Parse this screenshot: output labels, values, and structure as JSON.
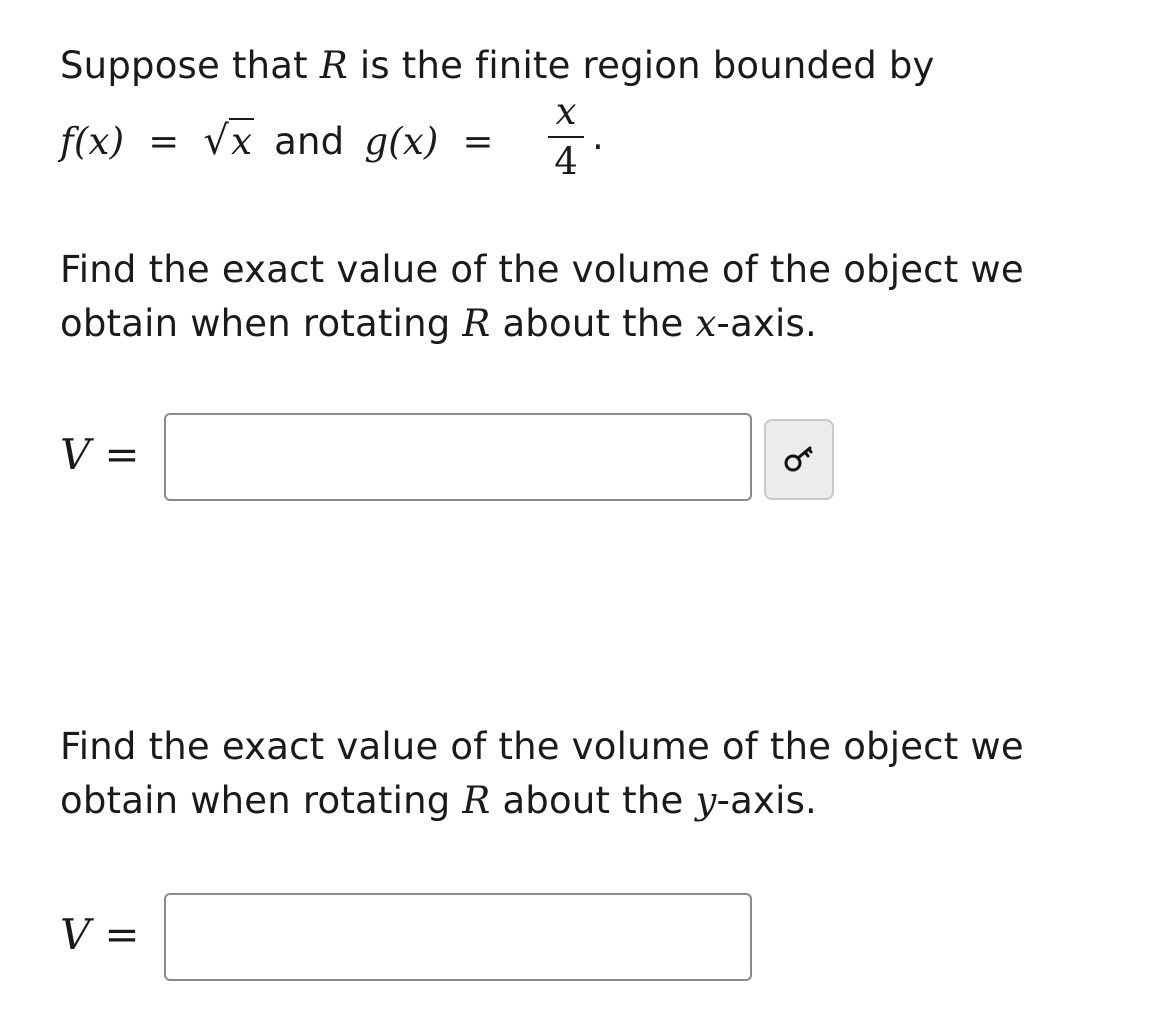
{
  "intro": {
    "pre": "Suppose that",
    "region": "R",
    "post": "is the finite region bounded by",
    "f_lhs": "f(x)",
    "equals": "=",
    "sqrt_symbol": "√",
    "f_rhs": "x",
    "and": "and",
    "g_lhs": "g(x)",
    "g_num": "x",
    "g_den": "4",
    "period": "."
  },
  "question1": {
    "line1": "Find the exact value of the volume of the object we",
    "line2_pre": "obtain when rotating",
    "region": "R",
    "line2_mid": "about the",
    "axis_var": "x",
    "line2_post": "-axis."
  },
  "answer1": {
    "label_var": "V",
    "label_eq": "=",
    "value": ""
  },
  "key_button": {
    "icon": "key-icon"
  },
  "question2": {
    "line1": "Find the exact value of the volume of the object we",
    "line2_pre": "obtain when rotating",
    "region": "R",
    "line2_mid": "about the",
    "axis_var": "y",
    "line2_post": "-axis."
  },
  "answer2": {
    "label_var": "V",
    "label_eq": "=",
    "value": ""
  }
}
